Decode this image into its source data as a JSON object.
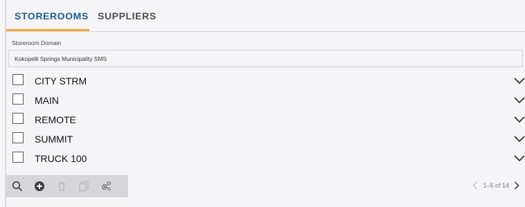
{
  "tabs": [
    {
      "label": "STOREROOMS",
      "active": true
    },
    {
      "label": "SUPPLIERS",
      "active": false
    }
  ],
  "domain": {
    "label": "Storeroom Domain",
    "value": "Kokopelli Springs Municipality SMS"
  },
  "storerooms": [
    {
      "name": "CITY STRM"
    },
    {
      "name": "MAIN"
    },
    {
      "name": "REMOTE"
    },
    {
      "name": "SUMMIT"
    },
    {
      "name": "TRUCK 100"
    }
  ],
  "toolbar": {
    "icons": [
      "search-icon",
      "add-icon",
      "delete-icon",
      "copy-icon",
      "settings-icon"
    ]
  },
  "pager": {
    "text": "1–5 of 14"
  },
  "colors": {
    "active_tab": "#1b5e91",
    "tab_underline": "#f2a531",
    "toolbar_bg": "#d6d6db"
  }
}
